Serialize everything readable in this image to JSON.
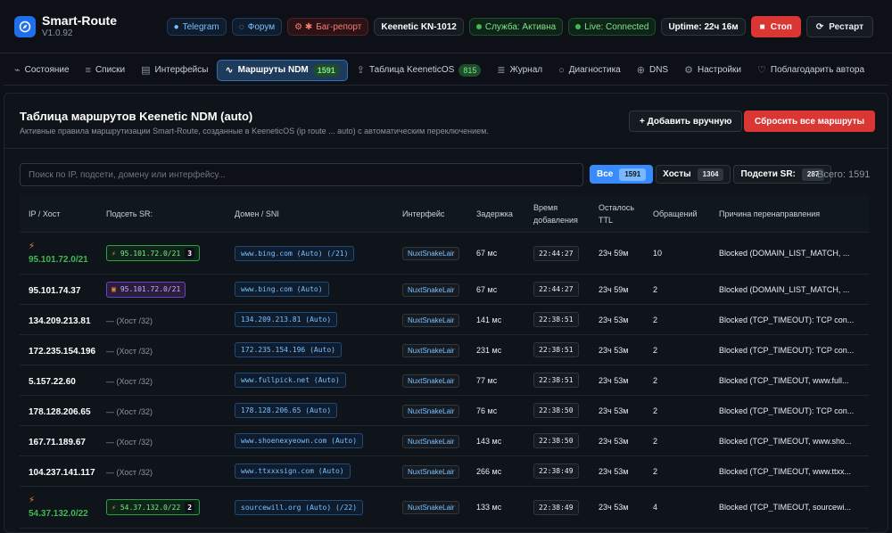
{
  "app": {
    "title": "Smart-Route",
    "version": "V1.0.92"
  },
  "header": {
    "telegram": "Telegram",
    "forum": "Форум",
    "bug": "Баг-репорт",
    "model": "Keenetic KN-1012",
    "service": "Служба: Активна",
    "live": "Live: Connected",
    "uptime": "Uptime: 22ч 16м",
    "stop": "Стоп",
    "restart": "Рестарт"
  },
  "nav": {
    "tabs": [
      {
        "label": "Состояние",
        "icon": "activity-icon"
      },
      {
        "label": "Списки",
        "icon": "list-icon"
      },
      {
        "label": "Интерфейсы",
        "icon": "server-icon"
      },
      {
        "label": "Маршруты NDM",
        "icon": "pulse-icon",
        "badge": "1591",
        "active": true
      },
      {
        "label": "Таблица KeeneticOS",
        "icon": "upload-icon",
        "badge": "815"
      },
      {
        "label": "Журнал",
        "icon": "log-icon"
      },
      {
        "label": "Диагностика",
        "icon": "search-icon"
      },
      {
        "label": "DNS",
        "icon": "globe-icon"
      },
      {
        "label": "Настройки",
        "icon": "gear-icon"
      },
      {
        "label": "Поблагодарить автора",
        "icon": "heart-icon"
      }
    ]
  },
  "panel": {
    "title": "Таблица маршрутов Keenetic NDM (auto)",
    "subtitle": "Активные правила маршрутизации Smart-Route, созданные в KeeneticOS (ip route ... auto) с автоматическим переключением.",
    "add_label": "+ Добавить вручную",
    "reset_label": "Сбросить все маршруты"
  },
  "search": {
    "placeholder": "Поиск по IP, подсети, домену или интерфейсу..."
  },
  "filters": {
    "all": {
      "label": "Все",
      "count": "1591"
    },
    "hosts": {
      "label": "Хосты",
      "count": "1304"
    },
    "subnets": {
      "label": "Подсети SR:",
      "count": "287"
    },
    "total": "Всего: 1591"
  },
  "table": {
    "headers": {
      "ip": "IP / Хост",
      "subnet": "Подсеть SR:",
      "domain": "Домен / SNI",
      "iface": "Интерфейс",
      "delay": "Задержка",
      "time_l1": "Время",
      "time_l2": "добавления",
      "ttl_l1": "Осталось",
      "ttl_l2": "TTL",
      "hits": "Обращений",
      "reason": "Причина перенаправления"
    },
    "rows": [
      {
        "ip": "95.101.72.0/21",
        "bolt": true,
        "subnet": "95.101.72.0/21",
        "subnet_kind": "green",
        "subnet_n": "3",
        "domain": "www.bing.com (Auto) (/21)",
        "iface": "NuxtSnakeLair",
        "delay": "67 мс",
        "time": "22:44:27",
        "ttl": "23ч 59м",
        "hits": "10",
        "reason": "Blocked (DOMAIN_LIST_MATCH, ..."
      },
      {
        "ip": "95.101.74.37",
        "bolt": false,
        "subnet": "95.101.72.0/21",
        "subnet_kind": "purple",
        "domain": "www.bing.com (Auto)",
        "iface": "NuxtSnakeLair",
        "delay": "67 мс",
        "time": "22:44:27",
        "ttl": "23ч 59м",
        "hits": "2",
        "reason": "Blocked (DOMAIN_LIST_MATCH, ..."
      },
      {
        "ip": "134.209.213.81",
        "bolt": false,
        "subnet": "— (Хост /32)",
        "subnet_kind": "host",
        "domain": "134.209.213.81 (Auto)",
        "iface": "NuxtSnakeLair",
        "delay": "141 мс",
        "time": "22:38:51",
        "ttl": "23ч 53м",
        "hits": "2",
        "reason": "Blocked (TCP_TIMEOUT): TCP con..."
      },
      {
        "ip": "172.235.154.196",
        "bolt": false,
        "subnet": "— (Хост /32)",
        "subnet_kind": "host",
        "domain": "172.235.154.196 (Auto)",
        "iface": "NuxtSnakeLair",
        "delay": "231 мс",
        "time": "22:38:51",
        "ttl": "23ч 53м",
        "hits": "2",
        "reason": "Blocked (TCP_TIMEOUT): TCP con..."
      },
      {
        "ip": "5.157.22.60",
        "bolt": false,
        "subnet": "— (Хост /32)",
        "subnet_kind": "host",
        "domain": "www.fullpick.net (Auto)",
        "iface": "NuxtSnakeLair",
        "delay": "77 мс",
        "time": "22:38:51",
        "ttl": "23ч 53м",
        "hits": "2",
        "reason": "Blocked (TCP_TIMEOUT, www.full..."
      },
      {
        "ip": "178.128.206.65",
        "bolt": false,
        "subnet": "— (Хост /32)",
        "subnet_kind": "host",
        "domain": "178.128.206.65 (Auto)",
        "iface": "NuxtSnakeLair",
        "delay": "76 мс",
        "time": "22:38:50",
        "ttl": "23ч 53м",
        "hits": "2",
        "reason": "Blocked (TCP_TIMEOUT): TCP con..."
      },
      {
        "ip": "167.71.189.67",
        "bolt": false,
        "subnet": "— (Хост /32)",
        "subnet_kind": "host",
        "domain": "www.shoenexyeown.com (Auto)",
        "iface": "NuxtSnakeLair",
        "delay": "143 мс",
        "time": "22:38:50",
        "ttl": "23ч 53м",
        "hits": "2",
        "reason": "Blocked (TCP_TIMEOUT, www.sho..."
      },
      {
        "ip": "104.237.141.117",
        "bolt": false,
        "subnet": "— (Хост /32)",
        "subnet_kind": "host",
        "domain": "www.ttxxxsign.com (Auto)",
        "iface": "NuxtSnakeLair",
        "delay": "266 мс",
        "time": "22:38:49",
        "ttl": "23ч 53м",
        "hits": "2",
        "reason": "Blocked (TCP_TIMEOUT, www.ttxx..."
      },
      {
        "ip": "54.37.132.0/22",
        "bolt": true,
        "subnet": "54.37.132.0/22",
        "subnet_kind": "green",
        "subnet_n": "2",
        "domain": "sourcewill.org (Auto) (/22)",
        "iface": "NuxtSnakeLair",
        "delay": "133 мс",
        "time": "22:38:49",
        "ttl": "23ч 53м",
        "hits": "4",
        "reason": "Blocked (TCP_TIMEOUT, sourcewi..."
      }
    ]
  }
}
